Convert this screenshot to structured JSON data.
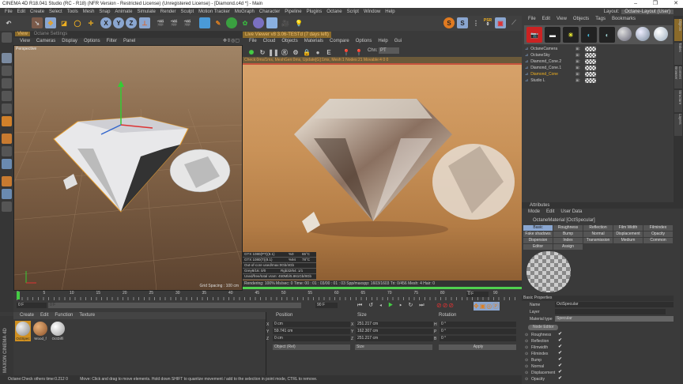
{
  "window": {
    "title": "CINEMA 4D R18.041 Studio (RC - R18) (NFR Version - Restricted License) (Unregistered License) - [Diamond.c4d *] - Main",
    "minimize": "–",
    "maximize": "❐",
    "close": "✕"
  },
  "menu": [
    "File",
    "Edit",
    "Create",
    "Select",
    "Tools",
    "Mesh",
    "Snap",
    "Animate",
    "Simulate",
    "Render",
    "Sculpt",
    "Motion Tracker",
    "MoGraph",
    "Character",
    "Pipeline",
    "Plugins",
    "Octane",
    "Script",
    "Window",
    "Help"
  ],
  "layout": {
    "label": "Layout:",
    "value": "Octane-Layout (User)"
  },
  "toolbar": {
    "axis": [
      "X",
      "Y",
      "Z"
    ],
    "psr_label": "PSR",
    "psr_value": "0",
    "s1": "S",
    "s2": "S"
  },
  "viewport": {
    "tabs": [
      "View",
      "Octane Settings"
    ],
    "menu": [
      "View",
      "Cameras",
      "Display",
      "Options",
      "Filter",
      "Panel"
    ],
    "label": "Perspective",
    "grid_spacing": "Grid Spacing : 100 cm"
  },
  "live_viewer": {
    "title": "Live Viewer v8 3.06-TESTd (7 days left)",
    "menu": [
      "File",
      "Cloud",
      "Objects",
      "Materials",
      "Compare",
      "Options",
      "Help",
      "Gui"
    ],
    "chn_label": "Chn:",
    "chn_value": "PT",
    "status": "Check:0ms/1ms, MeshGen:0ms, Update[G]:1ms, Mesh:1 Nodes:21 Movable:4  0 0",
    "gpu": [
      {
        "name": "GTX 1080(PT)(8.1)",
        "usage": "%0",
        "temp": "65°C"
      },
      {
        "name": "GTX 1080(T)(8.1)",
        "usage": "%94",
        "temp": "78°C"
      }
    ],
    "out_of_core": "Out-of-core used/max:0Gb/4Gb",
    "grey": "Grey8/16: 0/0",
    "rgb": "Rgb32/64: 1/1",
    "vram": "Used/free/total vram: 450Mb/5.861Gb/8Gb",
    "render_status": "Rendering: 100%  Ms/sec: 0   Time: 00 : 01 : 03/00 : 01 : 03  Spp/maxspp: 1603/1603   Tri: 0/456   Mesh: 4  Hair: 0",
    "progress": 1.0
  },
  "timeline": {
    "ticks": [
      "0",
      "5",
      "10",
      "15",
      "20",
      "25",
      "30",
      "35",
      "40",
      "45",
      "50",
      "55",
      "60",
      "65",
      "70",
      "75",
      "80",
      "85",
      "90"
    ],
    "current_frame": "0 F",
    "start": "0 F",
    "end": "90 F",
    "end_field": "90 F",
    "right_field": "0 F"
  },
  "materials": {
    "menu": [
      "Create",
      "Edit",
      "Function",
      "Texture"
    ],
    "items": [
      {
        "name": "OctSpec",
        "selected": true
      },
      {
        "name": "Wood_f"
      },
      {
        "name": "OctDiffi"
      }
    ]
  },
  "coords": {
    "headers": [
      "Position",
      "Size",
      "Rotation"
    ],
    "rows": [
      {
        "axis": "X",
        "pos": "0 cm",
        "saxis": "X",
        "size": "251.217 cm",
        "raxis": "H",
        "rot": "0 °"
      },
      {
        "axis": "Y",
        "pos": "59.741 cm",
        "saxis": "Y",
        "size": "162.307 cm",
        "raxis": "P",
        "rot": "0 °"
      },
      {
        "axis": "Z",
        "pos": "0 cm",
        "saxis": "Z",
        "size": "251.217 cm",
        "raxis": "B",
        "rot": "0 °"
      }
    ],
    "mode": "Object (Rel)",
    "size_mode": "Size",
    "apply": "Apply"
  },
  "statusbar": {
    "left": "Octane:Check others time:0.212  0",
    "message": "Move: Click and drag to move elements. Hold down SHIFT to quantize movement / add to the selection in point mode, CTRL to remove."
  },
  "objects": {
    "menu": [
      "File",
      "Edit",
      "View",
      "Objects",
      "Tags",
      "Bookmarks"
    ],
    "items": [
      {
        "name": "OctaneCamera"
      },
      {
        "name": "OctaneSky"
      },
      {
        "name": "Diamond_Cone.2"
      },
      {
        "name": "Diamond_Cone.1"
      },
      {
        "name": "Diamond_Cone",
        "selected": true
      },
      {
        "name": "Studio L"
      }
    ]
  },
  "right_tabs": [
    "Objects",
    "Takes",
    "Content Browser",
    "Structure",
    "Layers"
  ],
  "attributes": {
    "title": "Attributes",
    "menu": [
      "Mode",
      "Edit",
      "User Data"
    ],
    "material": "OctaneMaterial [OctSpecular]",
    "tabs": [
      "Basic",
      "Roughness",
      "Reflection",
      "Film Width",
      "Filmindex",
      "Fake shadows",
      "Bump",
      "Normal",
      "Displacement",
      "Opacity",
      "Dispersion",
      "Index",
      "Transmission",
      "Medium",
      "Common",
      "Editor",
      "Assign"
    ],
    "section": "Basic Properties",
    "name_label": "Name",
    "name_value": "OctSpecular",
    "layer_label": "Layer",
    "type_label": "Material type",
    "type_value": "Specular",
    "node_editor": "Node Editor",
    "channels": [
      "Roughness",
      "Reflection",
      "Filmwidth",
      "Filmindex",
      "Bump",
      "Normal",
      "Displacement",
      "Opacity"
    ]
  },
  "branding": "MAXON CINEMA 4D"
}
